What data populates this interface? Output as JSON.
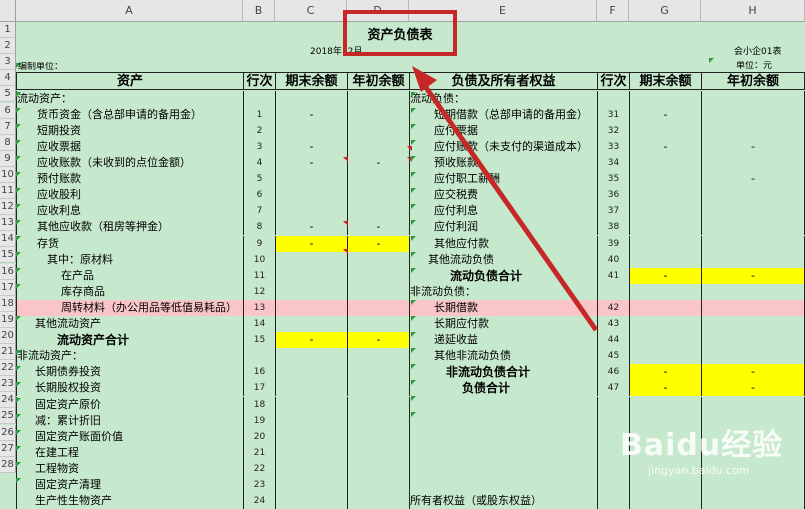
{
  "columns": [
    "A",
    "B",
    "C",
    "D",
    "E",
    "F",
    "G",
    "H"
  ],
  "rows": [
    "1",
    "2",
    "3",
    "4",
    "5",
    "6",
    "7",
    "8",
    "9",
    "10",
    "11",
    "12",
    "13",
    "14",
    "15",
    "16",
    "17",
    "18",
    "19",
    "20",
    "21",
    "22",
    "23",
    "24",
    "25",
    "26",
    "27",
    "28"
  ],
  "sheet": {
    "title": "资产负债表",
    "date": "2018年12月",
    "form_code": "会小企01表",
    "unit_label": "单位：元",
    "prepared_by": "编制单位：",
    "headers": {
      "asset": "资产",
      "row_no": "行次",
      "end_balance": "期末余额",
      "begin_balance": "年初余额",
      "liability": "负债及所有者权益",
      "row_no2": "行次",
      "end_balance2": "期末余额",
      "begin_balance2": "年初余额"
    },
    "left": [
      {
        "label": "流动资产：",
        "no": ""
      },
      {
        "label": "货币资金（含总部申请的备用金）",
        "no": "1",
        "c": "-"
      },
      {
        "label": "短期投资",
        "no": "2"
      },
      {
        "label": "应收票据",
        "no": "3",
        "c": "-"
      },
      {
        "label": "应收账款（未收到的点位金额）",
        "no": "4",
        "c": "-",
        "d": "-"
      },
      {
        "label": "预付账款",
        "no": "5"
      },
      {
        "label": "应收股利",
        "no": "6"
      },
      {
        "label": "应收利息",
        "no": "7"
      },
      {
        "label": "其他应收款（租房等押金）",
        "no": "8",
        "c": "-",
        "d": "-"
      },
      {
        "label": "存货",
        "no": "9",
        "c": "-",
        "d": "-"
      },
      {
        "label": "其中：原材料",
        "no": "10"
      },
      {
        "label": "在产品",
        "no": "11"
      },
      {
        "label": "库存商品",
        "no": "12"
      },
      {
        "label": "周转材料（办公用品等低值易耗品）",
        "no": "13"
      },
      {
        "label": "其他流动资产",
        "no": "14"
      },
      {
        "label": "流动资产合计",
        "no": "15",
        "c": "-",
        "d": "-"
      },
      {
        "label": "非流动资产：",
        "no": ""
      },
      {
        "label": "长期债券投资",
        "no": "16"
      },
      {
        "label": "长期股权投资",
        "no": "17"
      },
      {
        "label": "固定资产原价",
        "no": "18"
      },
      {
        "label": "减：累计折旧",
        "no": "19"
      },
      {
        "label": "固定资产账面价值",
        "no": "20"
      },
      {
        "label": "在建工程",
        "no": "21"
      },
      {
        "label": "工程物资",
        "no": "22"
      },
      {
        "label": "固定资产清理",
        "no": "23"
      },
      {
        "label": "生产性生物资产",
        "no": "24"
      }
    ],
    "right": [
      {
        "label": "流动负债：",
        "no": ""
      },
      {
        "label": "短期借款（总部申请的备用金）",
        "no": "31",
        "g": "-"
      },
      {
        "label": "应付票据",
        "no": "32"
      },
      {
        "label": "应付账款（未支付的渠道成本）",
        "no": "33",
        "g": "-",
        "h": "-"
      },
      {
        "label": "预收账款",
        "no": "34"
      },
      {
        "label": "应付职工薪酬",
        "no": "35",
        "h": "-"
      },
      {
        "label": "应交税费",
        "no": "36"
      },
      {
        "label": "应付利息",
        "no": "37"
      },
      {
        "label": "应付利润",
        "no": "38"
      },
      {
        "label": "其他应付款",
        "no": "39"
      },
      {
        "label": "其他流动负债",
        "no": "40"
      },
      {
        "label": "流动负债合计",
        "no": "41",
        "g": "-",
        "h": "-"
      },
      {
        "label": "非流动负债：",
        "no": ""
      },
      {
        "label": "长期借款",
        "no": "42"
      },
      {
        "label": "长期应付款",
        "no": "43"
      },
      {
        "label": "递延收益",
        "no": "44"
      },
      {
        "label": "其他非流动负债",
        "no": "45"
      },
      {
        "label": "非流动负债合计",
        "no": "46",
        "g": "-",
        "h": "-"
      },
      {
        "label": "负债合计",
        "no": "47",
        "g": "-",
        "h": "-"
      },
      {
        "label": "",
        "no": ""
      },
      {
        "label": "",
        "no": ""
      },
      {
        "label": "",
        "no": ""
      },
      {
        "label": "",
        "no": ""
      },
      {
        "label": "",
        "no": ""
      },
      {
        "label": "",
        "no": ""
      },
      {
        "label": "所有者权益（或股东权益）",
        "no": ""
      }
    ]
  },
  "watermark": {
    "brand": "Baidu经验",
    "url": "jingyan.baidu.com"
  },
  "colors": {
    "grid_bg": "#c6e8cc",
    "highlight_yellow": "#ffff00",
    "highlight_pink": "#f9c5c8",
    "annotation_red": "#c62828"
  }
}
